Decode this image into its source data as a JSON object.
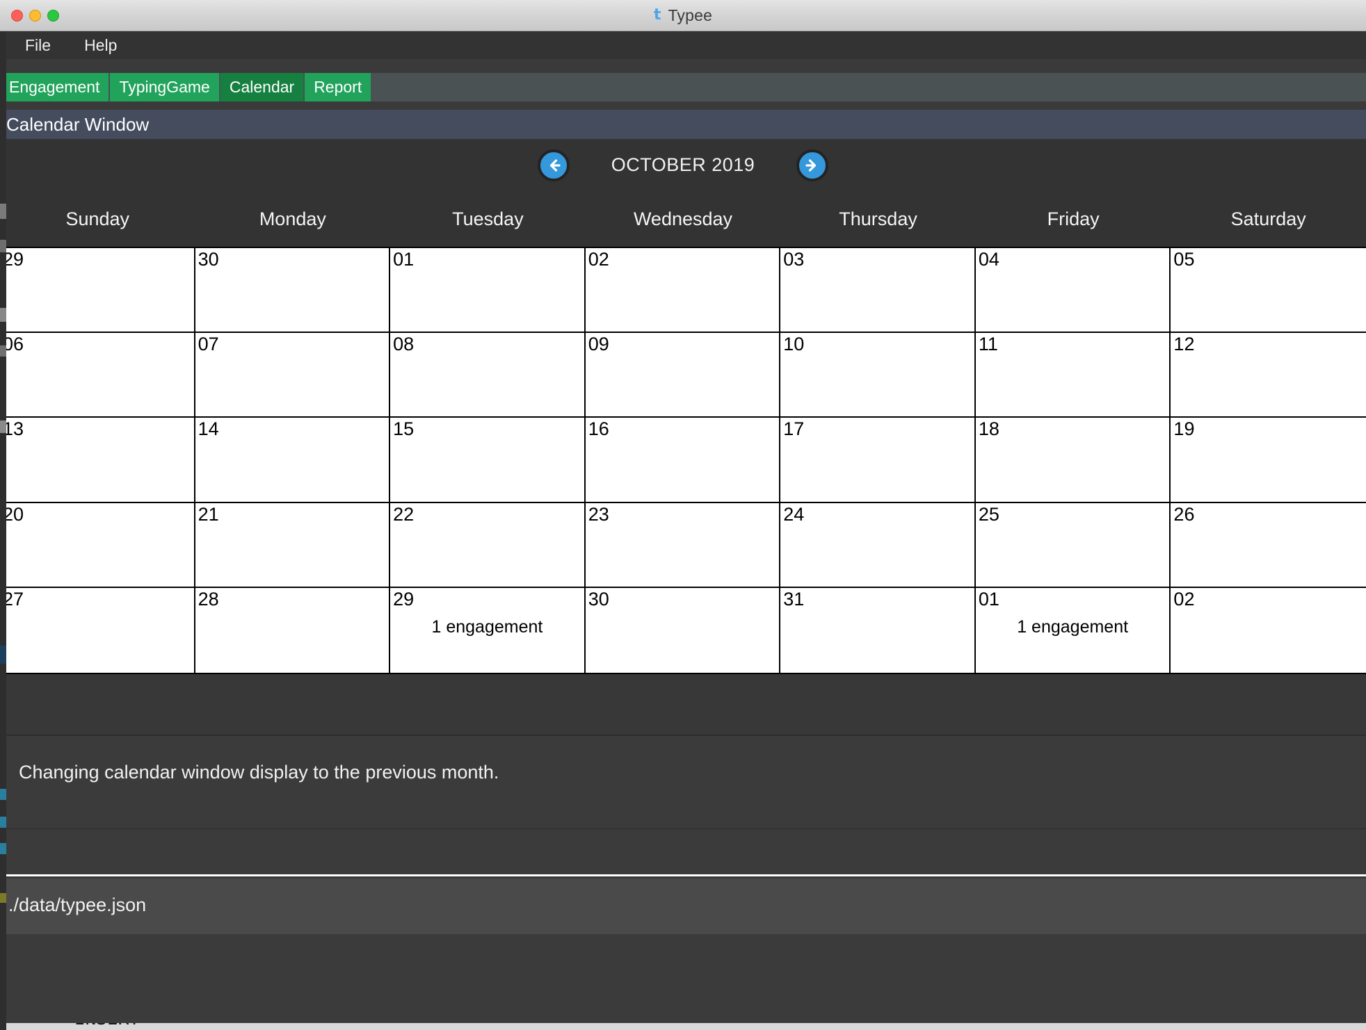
{
  "window": {
    "title": "Typee",
    "app_icon": "typee-logo-icon",
    "traffic_lights": [
      "close",
      "minimize",
      "maximize"
    ]
  },
  "menubar": {
    "items": [
      {
        "label": "File"
      },
      {
        "label": "Help"
      }
    ]
  },
  "tabs": {
    "items": [
      {
        "label": "Engagement",
        "active": false
      },
      {
        "label": "TypingGame",
        "active": false
      },
      {
        "label": "Calendar",
        "active": true
      },
      {
        "label": "Report",
        "active": false
      }
    ],
    "active_color": "#158040",
    "inactive_color": "#22a35c",
    "bar_color": "#4a5254"
  },
  "window_header": {
    "label": "Calendar Window",
    "background": "#444c5e"
  },
  "calendar": {
    "month_label": "OCTOBER 2019",
    "prev_button": "previous-month",
    "next_button": "next-month",
    "accent_color": "#3498db",
    "weekdays": [
      "Sunday",
      "Monday",
      "Tuesday",
      "Wednesday",
      "Thursday",
      "Friday",
      "Saturday"
    ],
    "cells": [
      {
        "day": "29",
        "event": ""
      },
      {
        "day": "30",
        "event": ""
      },
      {
        "day": "01",
        "event": ""
      },
      {
        "day": "02",
        "event": ""
      },
      {
        "day": "03",
        "event": ""
      },
      {
        "day": "04",
        "event": ""
      },
      {
        "day": "05",
        "event": ""
      },
      {
        "day": "06",
        "event": ""
      },
      {
        "day": "07",
        "event": ""
      },
      {
        "day": "08",
        "event": ""
      },
      {
        "day": "09",
        "event": ""
      },
      {
        "day": "10",
        "event": ""
      },
      {
        "day": "11",
        "event": ""
      },
      {
        "day": "12",
        "event": ""
      },
      {
        "day": "13",
        "event": ""
      },
      {
        "day": "14",
        "event": ""
      },
      {
        "day": "15",
        "event": ""
      },
      {
        "day": "16",
        "event": ""
      },
      {
        "day": "17",
        "event": ""
      },
      {
        "day": "18",
        "event": ""
      },
      {
        "day": "19",
        "event": ""
      },
      {
        "day": "20",
        "event": ""
      },
      {
        "day": "21",
        "event": ""
      },
      {
        "day": "22",
        "event": ""
      },
      {
        "day": "23",
        "event": ""
      },
      {
        "day": "24",
        "event": ""
      },
      {
        "day": "25",
        "event": ""
      },
      {
        "day": "26",
        "event": ""
      },
      {
        "day": "27",
        "event": ""
      },
      {
        "day": "28",
        "event": ""
      },
      {
        "day": "29",
        "event": "1 engagement"
      },
      {
        "day": "30",
        "event": ""
      },
      {
        "day": "31",
        "event": ""
      },
      {
        "day": "01",
        "event": "1 engagement"
      },
      {
        "day": "02",
        "event": ""
      }
    ]
  },
  "status": {
    "message": "Changing calendar window display to the previous month."
  },
  "file": {
    "path": "./data/typee.json"
  },
  "background_bleed": {
    "text": "-- INSERT --"
  }
}
